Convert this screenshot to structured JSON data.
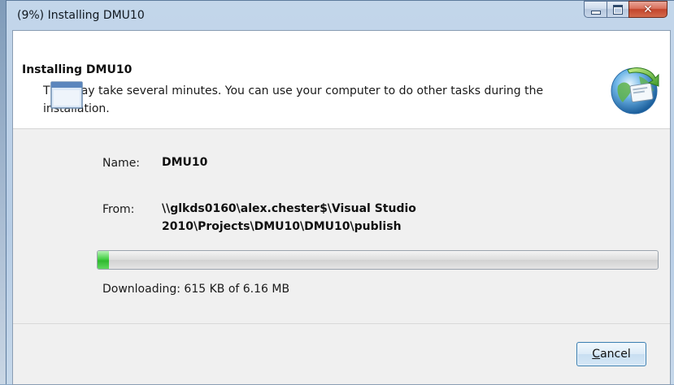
{
  "window": {
    "title": "(9%) Installing DMU10"
  },
  "header": {
    "title": "Installing DMU10",
    "description": "This may take several minutes. You can use your computer to do other tasks during the installation."
  },
  "details": {
    "name_label": "Name:",
    "name_value": "DMU10",
    "from_label": "From:",
    "from_value_line1": "\\\\glkds0160\\alex.chester$\\Visual Studio",
    "from_value_line2": "2010\\Projects\\DMU10\\DMU10\\publish"
  },
  "progress": {
    "fraction": 0.02,
    "status_text": "Downloading: 615 KB of 6.16 MB"
  },
  "buttons": {
    "cancel_accesskey": "C",
    "cancel_rest": "ancel"
  },
  "icons": {
    "minimize": "minimize-icon",
    "maximize": "maximize-icon",
    "close": "close-icon",
    "installer": "globe-installer-icon",
    "app": "application-window-icon"
  },
  "colors": {
    "progress_fill": "#2fb92f",
    "close_button": "#c3452c"
  }
}
